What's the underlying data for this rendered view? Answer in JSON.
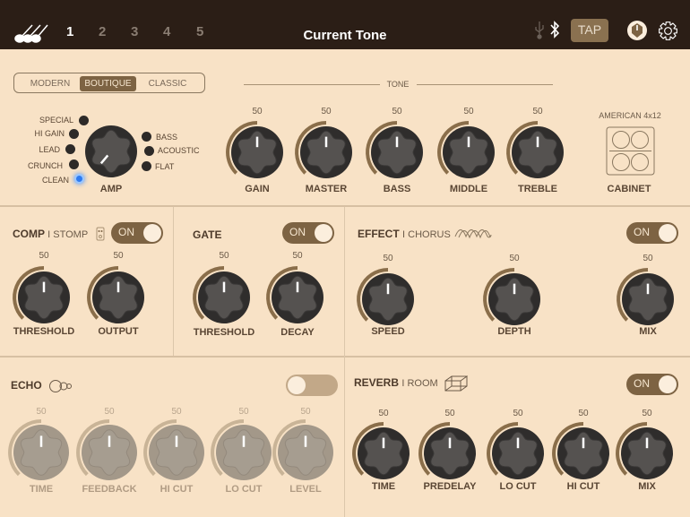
{
  "header": {
    "presets": [
      "1",
      "2",
      "3",
      "4",
      "5"
    ],
    "active_preset": "1",
    "title": "Current Tone",
    "tap_label": "TAP",
    "icons": [
      "guitars-icon",
      "usb-icon",
      "bluetooth-icon",
      "tuner-knob-icon",
      "gear-icon"
    ]
  },
  "amp": {
    "modes": [
      "MODERN",
      "BOUTIQUE",
      "CLASSIC"
    ],
    "selected_mode": "BOUTIQUE",
    "types_left": [
      "SPECIAL",
      "HI GAIN",
      "LEAD",
      "CRUNCH",
      "CLEAN"
    ],
    "types_right": [
      "BASS",
      "ACOUSTIC",
      "FLAT"
    ],
    "selected_type": "CLEAN",
    "label": "AMP"
  },
  "tone": {
    "label": "TONE",
    "knobs": [
      {
        "label": "GAIN",
        "value": "50"
      },
      {
        "label": "MASTER",
        "value": "50"
      },
      {
        "label": "BASS",
        "value": "50"
      },
      {
        "label": "MIDDLE",
        "value": "50"
      },
      {
        "label": "TREBLE",
        "value": "50"
      }
    ]
  },
  "cabinet": {
    "name": "AMERICAN 4x12",
    "label": "CABINET"
  },
  "comp": {
    "title": "COMP",
    "type": "I STOMP",
    "toggle": "ON",
    "knobs": [
      {
        "label": "THRESHOLD",
        "value": "50"
      },
      {
        "label": "OUTPUT",
        "value": "50"
      }
    ]
  },
  "gate": {
    "title": "GATE",
    "toggle": "ON",
    "knobs": [
      {
        "label": "THRESHOLD",
        "value": "50"
      },
      {
        "label": "DECAY",
        "value": "50"
      }
    ]
  },
  "effect": {
    "title": "EFFECT",
    "type": "I CHORUS",
    "toggle": "ON",
    "knobs": [
      {
        "label": "SPEED",
        "value": "50"
      },
      {
        "label": "DEPTH",
        "value": "50"
      },
      {
        "label": "MIX",
        "value": "50"
      }
    ]
  },
  "echo": {
    "title": "ECHO",
    "enabled": false,
    "knobs": [
      {
        "label": "TIME",
        "value": "50"
      },
      {
        "label": "FEEDBACK",
        "value": "50"
      },
      {
        "label": "HI CUT",
        "value": "50"
      },
      {
        "label": "LO CUT",
        "value": "50"
      },
      {
        "label": "LEVEL",
        "value": "50"
      }
    ]
  },
  "reverb": {
    "title": "REVERB",
    "type": "I ROOM",
    "toggle": "ON",
    "knobs": [
      {
        "label": "TIME",
        "value": "50"
      },
      {
        "label": "PREDELAY",
        "value": "50"
      },
      {
        "label": "LO CUT",
        "value": "50"
      },
      {
        "label": "HI CUT",
        "value": "50"
      },
      {
        "label": "MIX",
        "value": "50"
      }
    ]
  },
  "colors": {
    "header": "#2b1e16",
    "background": "#f8e2c6",
    "accent": "#7d6343",
    "led_on": "#2f7bf0"
  }
}
